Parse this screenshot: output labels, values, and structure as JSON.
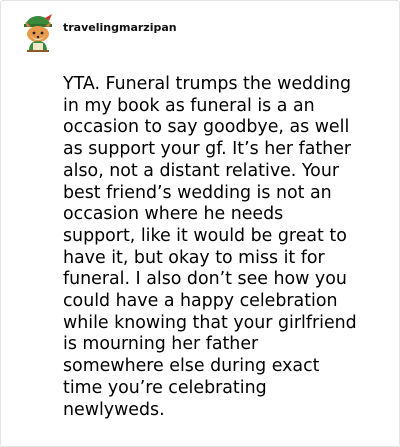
{
  "post": {
    "username": "travelingmarzipan",
    "avatar_icon": "fox-avatar-icon",
    "body_lines": [
      "YTA. Funeral trumps the wedding",
      "in my book as funeral is a an",
      "occasion to say goodbye, as well",
      "as support your gf. It’s her father",
      "also, not a distant relative. Your",
      "best friend’s wedding is not an",
      "occasion where he needs",
      "support, like it would be great to",
      "have it, but okay to miss it for",
      "funeral. I also don’t see how you",
      "could have a happy celebration",
      "while knowing that your girlfriend",
      "is mourning her father",
      "somewhere else during exact",
      "time you’re celebrating",
      "newlyweds."
    ]
  },
  "colors": {
    "text": "#000000",
    "border": "#e3e3e3",
    "avatar_hat": "#3a8a3c",
    "avatar_fur": "#e89a4a"
  }
}
